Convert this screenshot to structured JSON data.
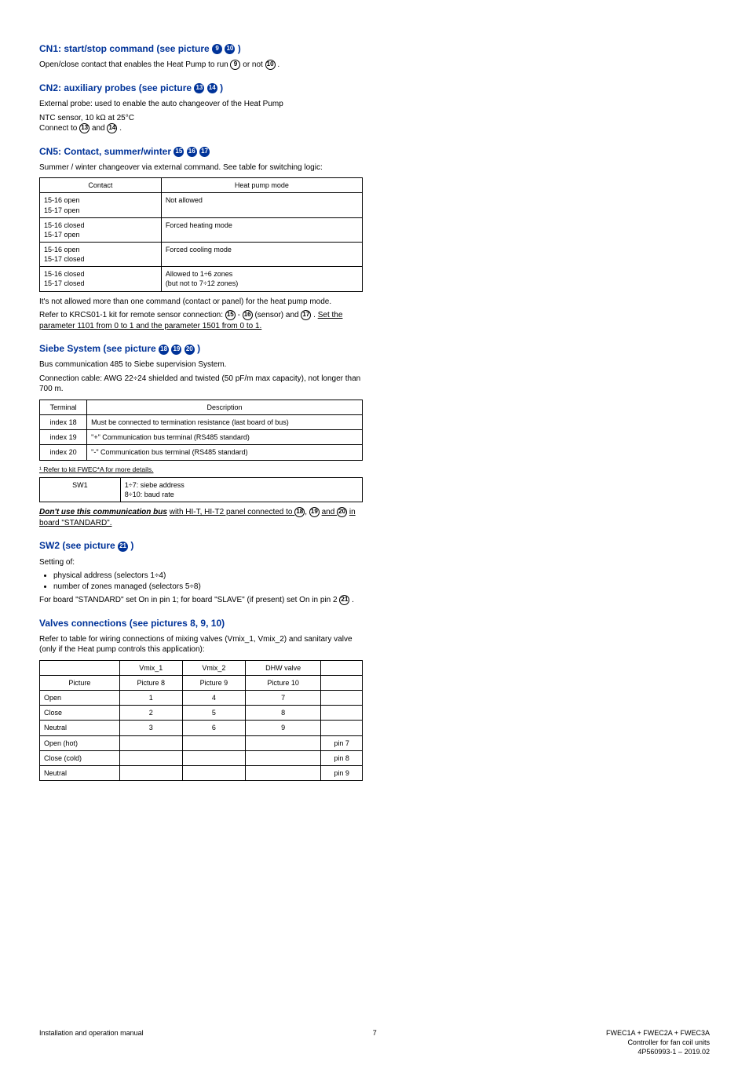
{
  "sec1": {
    "heading": "CN1: start/stop command (see picture ",
    "heading_refs": [
      "9",
      "10"
    ],
    "heading_tail": ")",
    "p1a": "Open/close contact that enables the Heat Pump to run ",
    "p1b": " or not ",
    "p1c": "."
  },
  "sec2": {
    "heading": "CN2: auxiliary probes (see picture ",
    "heading_refs": [
      "13",
      "14"
    ],
    "heading_tail": ")",
    "p1": "External probe: used to enable the auto changeover of the Heat Pump",
    "p2a": "NTC sensor, 10 kΩ at 25°C",
    "p2b_before": "Connect to ",
    "p2b_and": " and ",
    "p2b_end": "."
  },
  "sec3": {
    "heading": "CN5: Contact, summer/winter ",
    "heading_refs": [
      "15",
      "16",
      "17"
    ],
    "p1": "Summer / winter changeover via external command. See table for switching logic:",
    "table": {
      "r1c1": "Contact",
      "r1c2": "Heat pump mode",
      "r2c1": "15-16 open\n15-17 open",
      "r2c2": "Not allowed",
      "r3c1": "15-16 closed\n15-17 open",
      "r3c2": "Forced heating mode",
      "r4c1": "15-16 open\n15-17 closed",
      "r4c2": "Forced cooling mode",
      "r5c1": "15-16 closed\n15-17 closed",
      "r5c2": "Allowed to 1÷6 zones\n(but not to 7÷12 zones)"
    },
    "p2": "It's not allowed more than one command (contact or panel) for the heat pump mode.",
    "p3a": "Refer to KRCS01-1 kit for remote sensor connection: ",
    "p3b": " - ",
    "p3c": " (sensor) and ",
    "p3d": ". ",
    "p3e": "Set the parameter 1101 from 0 to 1 and the parameter 1501 from 0 to 1."
  },
  "sec4": {
    "heading": "Siebe System (see picture ",
    "heading_refs": [
      "18",
      "19",
      "20"
    ],
    "heading_tail": ")",
    "p1": "Bus communication 485 to Siebe supervision System.",
    "p2": "Connection cable: AWG 22÷24 shielded and twisted (50 pF/m max capacity), not longer than 700 m.",
    "table": {
      "r1c1": "Terminal",
      "r1c2": "Description",
      "r2c1": "index 18",
      "r2c2": "Must be connected to termination resistance (last board of bus)",
      "r3c1": "index 19",
      "r3c2": "\"+\" Communication bus terminal (RS485 standard)",
      "r4c1": "index 20",
      "r4c2": "\"-\" Communication bus terminal (RS485 standard)"
    },
    "note": "¹ Refer to kit FWEC*A for more details."
  },
  "sec5": {
    "table": {
      "r1c1": "SW1",
      "r1c2": "1÷7: siebe address\n8÷10: baud rate"
    },
    "emph_pre": "Don't use this communication bus",
    "emph_post": " with HI-T, HI-T2 panel connected to ",
    "emph_refs": [
      "18",
      "19"
    ],
    "emph_and": " and ",
    "emph_ref3": "20",
    "emph_tail": " in board \"STANDARD\"."
  },
  "sec6": {
    "heading": "SW2 (see picture ",
    "heading_refs": [
      "21"
    ],
    "heading_tail": ")",
    "p1": "Setting of:",
    "li1": "physical address (selectors 1÷4)",
    "li2": "number of zones managed (selectors 5÷8)",
    "p2a": "For board \"STANDARD\" set On in pin 1; for board \"SLAVE\" (if present) set On in pin 2 ",
    "p2b": "."
  },
  "sec7": {
    "heading": "Valves connections (see pictures 8, 9, 10)",
    "p1": "Refer to table for wiring connections of mixing valves (Vmix_1, Vmix_2) and sanitary valve (only if the Heat pump controls this application):",
    "table": {
      "h1": "",
      "h2": "Vmix_1",
      "h3": "Vmix_2",
      "h4": "DHW valve",
      "h5": "",
      "r": [
        [
          "Picture",
          "Picture 8",
          "Picture 9",
          "Picture 10",
          ""
        ],
        [
          "Open",
          "1",
          "4",
          "7",
          ""
        ],
        [
          "Close",
          "2",
          "5",
          "8",
          ""
        ],
        [
          "Neutral",
          "3",
          "6",
          "9",
          ""
        ],
        [
          "Open (hot)",
          "",
          "",
          "",
          "pin 7"
        ],
        [
          "Close (cold)",
          "",
          "",
          "",
          "pin 8"
        ],
        [
          "Neutral",
          "",
          "",
          "",
          "pin 9"
        ]
      ]
    }
  },
  "footer": {
    "left": "Installation and operation manual",
    "center": "7",
    "rightTop": "FWEC1A + FWEC2A + FWEC3A",
    "rightMid": "Controller for fan coil units",
    "rightBot": "4P560993-1 – 2019.02"
  }
}
